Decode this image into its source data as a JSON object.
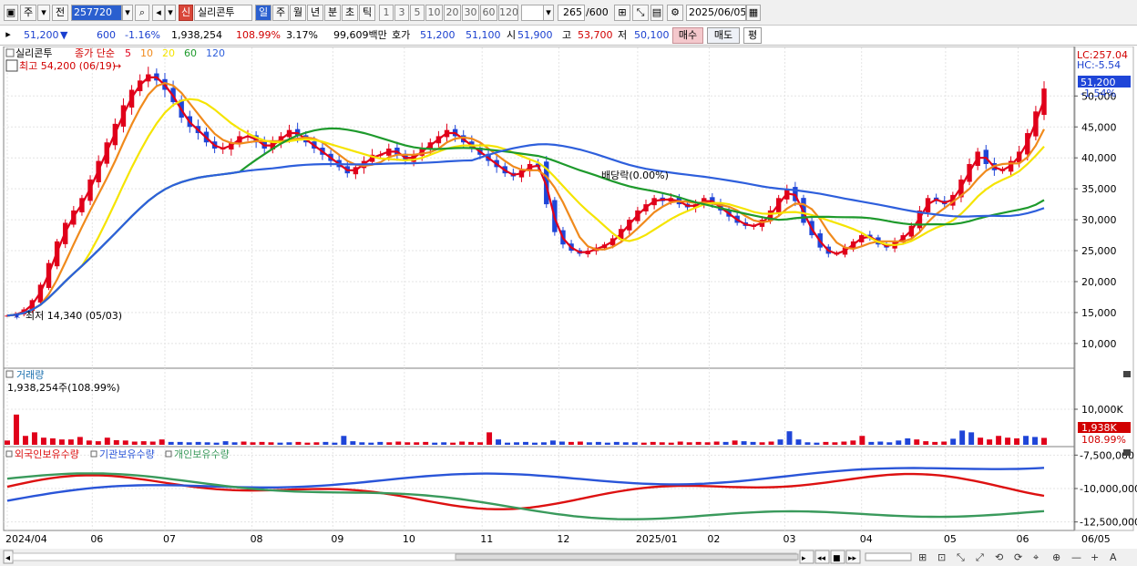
{
  "toolbar": {
    "market": "주",
    "prev": "전",
    "code": "257720",
    "stock_type": "신",
    "stock_name": "실리콘투",
    "periods": [
      "일",
      "주",
      "월",
      "년",
      "분",
      "초",
      "틱"
    ],
    "active_period": "일",
    "intervals": [
      "1",
      "3",
      "5",
      "10",
      "20",
      "30",
      "60",
      "120"
    ],
    "count": "265",
    "count_total": "/600",
    "date": "2025/06/05"
  },
  "quote": {
    "price": "51,200",
    "direction_icon": "down-triangle-icon",
    "change": "600",
    "change_pct": "-1.16%",
    "volume": "1,938,254",
    "volume_ratio": "108.99%",
    "turnover": "3.17%",
    "amount": "99,609백만",
    "ask_label": "호가",
    "ask": "51,200",
    "bid": "51,100",
    "open_label": "시",
    "open": "51,900",
    "high_label": "고",
    "high": "53,700",
    "low_label": "저",
    "low": "50,100",
    "buy_label": "매수",
    "sell_label": "매도",
    "eval_label": "평"
  },
  "price_panel": {
    "legend_name": "실리콘투",
    "legend_type": "종가 단순",
    "ma_periods": [
      "5",
      "10",
      "20",
      "60",
      "120"
    ],
    "high_note": "최고 54,200 (06/19)",
    "low_note": "최저 14,340 (05/03)",
    "dividend_note": "배당락(0.00%)",
    "lc": "LC:257.04",
    "hc": "HC:-5.54",
    "current_tag": "51,200",
    "current_pct": "-1.54%"
  },
  "volume_panel": {
    "title": "거래량",
    "value": "1,938,254주(108.99%)",
    "tag_value": "1,938K",
    "tag_pct": "108.99%"
  },
  "holding_panel": {
    "series": [
      "외국인보유수량",
      "기관보유수량",
      "개인보유수량"
    ]
  },
  "colors": {
    "up": "#e0001a",
    "down": "#1f45d8",
    "ma5": "#e0001a",
    "ma10": "#f08a1c",
    "ma20": "#f5e400",
    "ma60": "#1e9a2c",
    "ma120": "#2e5fdc",
    "foreign": "#dd1111",
    "institution": "#2a55d8",
    "individual": "#3a9a5c"
  },
  "chart_data": {
    "type": "candlestick",
    "x_ticks": [
      "2024/04",
      "06",
      "07",
      "08",
      "09",
      "10",
      "11",
      "12",
      "2025/01",
      "02",
      "03",
      "04",
      "05",
      "06",
      "06/05"
    ],
    "price_axis": {
      "ylim": [
        6000,
        58000
      ],
      "ticks": [
        "50,000",
        "45,000",
        "40,000",
        "35,000",
        "30,000",
        "25,000",
        "20,000",
        "15,000",
        "10,000"
      ]
    },
    "volume_axis": {
      "ticks": [
        "10,000K"
      ]
    },
    "holding_axis": {
      "ticks": [
        "-7,500,000",
        "-10,000,000",
        "-12,500,000"
      ]
    },
    "close_approx": [
      14500,
      14800,
      15500,
      17000,
      19500,
      23000,
      26500,
      29500,
      31500,
      33500,
      36500,
      39500,
      42500,
      45500,
      48500,
      51000,
      52500,
      53500,
      52500,
      51000,
      49000,
      46500,
      45000,
      44000,
      42500,
      41500,
      41500,
      42500,
      43500,
      43500,
      42500,
      41500,
      42500,
      43500,
      44500,
      43500,
      42500,
      41500,
      40500,
      39500,
      38500,
      37500,
      38500,
      39500,
      40500,
      40500,
      41500,
      40500,
      39500,
      40500,
      41500,
      42500,
      43500,
      44500,
      43500,
      42500,
      41500,
      40500,
      39500,
      38500,
      37500,
      37000,
      38000,
      39000,
      38500,
      32500,
      28000,
      26000,
      25000,
      24500,
      25000,
      25500,
      26000,
      27000,
      28500,
      30000,
      31500,
      32500,
      33500,
      33000,
      33500,
      32500,
      32000,
      32500,
      33500,
      32500,
      31500,
      30500,
      29500,
      29000,
      29000,
      30000,
      31500,
      33500,
      35000,
      33000,
      29500,
      27500,
      25500,
      24500,
      24500,
      25500,
      26500,
      27500,
      27000,
      26000,
      25500,
      26500,
      27500,
      29000,
      31500,
      33500,
      33000,
      32500,
      34000,
      36500,
      39000,
      41000,
      39000,
      38000,
      38000,
      39500,
      41000,
      44000,
      47500,
      51200
    ],
    "volume_bars_approx": [
      1200,
      8500,
      2500,
      3500,
      2000,
      1800,
      1500,
      1500,
      2200,
      1200,
      1000,
      2000,
      1300,
      1200,
      900,
      1000,
      900,
      1500,
      800,
      800,
      700,
      800,
      700,
      600,
      1000,
      700,
      900,
      700,
      800,
      700,
      600,
      700,
      800,
      600,
      700,
      800,
      600,
      2500,
      1000,
      700,
      600,
      800,
      700,
      900,
      700,
      700,
      800,
      600,
      700,
      600,
      900,
      800,
      700,
      3500,
      1500,
      600,
      700,
      800,
      600,
      700,
      1200,
      900,
      800,
      900,
      700,
      800,
      600,
      800,
      700,
      700,
      600,
      800,
      700,
      600,
      900,
      700,
      800,
      700,
      900,
      800,
      1200,
      1000,
      800,
      700,
      900,
      1500,
      3800,
      1500,
      700,
      600,
      800,
      700,
      900,
      1200,
      2500,
      800,
      900,
      700,
      1200,
      1800,
      1500,
      1000,
      800,
      900,
      1700,
      4000,
      3500,
      2000,
      1500,
      2500,
      2000,
      1800,
      2500,
      2200,
      1938
    ]
  }
}
